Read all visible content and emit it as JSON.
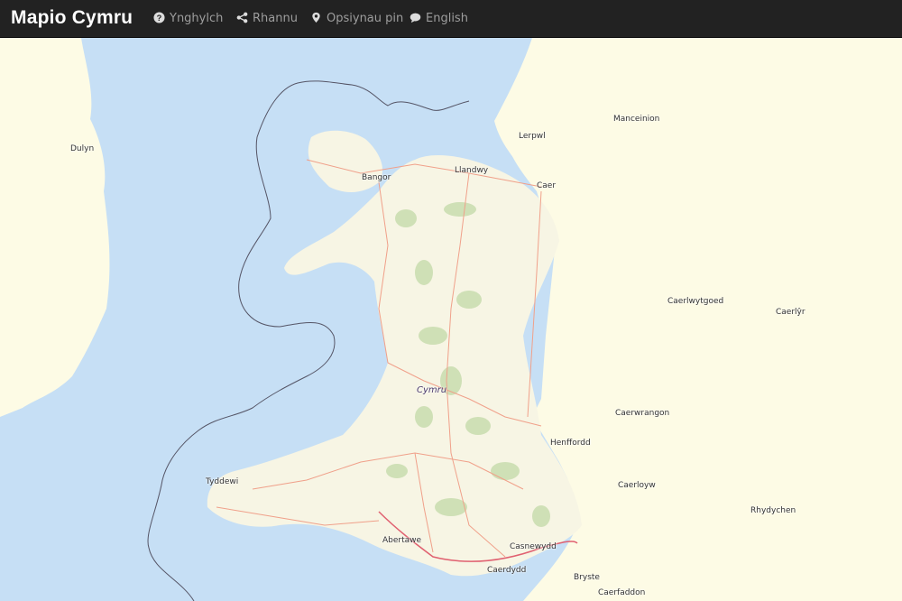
{
  "navbar": {
    "brand": "Mapio Cymru",
    "items": [
      {
        "label": "Ynghylch",
        "icon": "question-circle-icon"
      },
      {
        "label": "Rhannu",
        "icon": "share-icon"
      },
      {
        "label": "Opsiynau pin",
        "icon": "map-marker-icon"
      },
      {
        "label": "English",
        "icon": "comment-icon"
      }
    ]
  },
  "map": {
    "colors": {
      "sea": "#c6dff5",
      "land": "#fdfbe5",
      "wales": "#f7f5e4",
      "road": "#f0a08a",
      "motorway": "#e06070",
      "forest": "#cfe0b6",
      "boundary": "#555566"
    },
    "labels": {
      "country": "Cymru",
      "dulyn": "Dulyn",
      "bangor": "Bangor",
      "llandudno": "Llandwy",
      "lerpwl": "Lerpwl",
      "manceinion": "Manceinion",
      "caer": "Caer",
      "caerlwytgoed": "Caerlwytgoed",
      "caerlyr": "Caerlŷr",
      "caerwrangon": "Caerwrangon",
      "henffordd": "Henffordd",
      "caerloyw": "Caerloyw",
      "rhydychen": "Rhydychen",
      "tyddewi": "Tyddewi",
      "abertawe": "Abertawe",
      "casnewydd": "Casnewydd",
      "caerdydd": "Caerdydd",
      "bryste": "Bryste",
      "caerfaddon": "Caerfaddon"
    }
  }
}
